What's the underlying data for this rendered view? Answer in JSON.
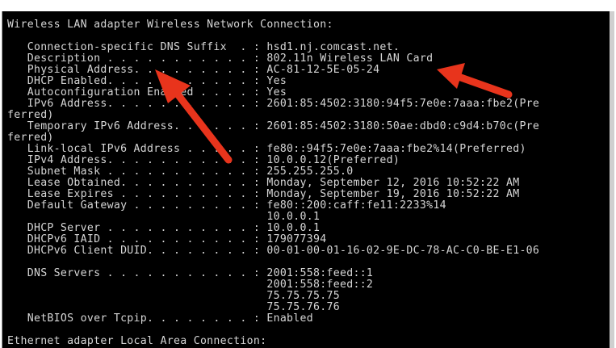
{
  "console": {
    "lines": [
      "Wireless LAN adapter Wireless Network Connection:",
      "",
      "   Connection-specific DNS Suffix  . : hsd1.nj.comcast.net.",
      "   Description . . . . . . . . . . . : 802.11n Wireless LAN Card",
      "   Physical Address. . . . . . . . . : AC-81-12-5E-05-24",
      "   DHCP Enabled. . . . . . . . . . . : Yes",
      "   Autoconfiguration Enabled . . . . : Yes",
      "   IPv6 Address. . . . . . . . . . . : 2601:85:4502:3180:94f5:7e0e:7aaa:fbe2(Pre",
      "ferred)",
      "   Temporary IPv6 Address. . . . . . : 2601:85:4502:3180:50ae:dbd0:c9d4:b70c(Pre",
      "ferred)",
      "   Link-local IPv6 Address . . . . . : fe80::94f5:7e0e:7aaa:fbe2%14(Preferred)",
      "   IPv4 Address. . . . . . . . . . . : 10.0.0.12(Preferred)",
      "   Subnet Mask . . . . . . . . . . . : 255.255.255.0",
      "   Lease Obtained. . . . . . . . . . : Monday, September 12, 2016 10:52:22 AM",
      "   Lease Expires . . . . . . . . . . : Monday, September 19, 2016 10:52:22 AM",
      "   Default Gateway . . . . . . . . . : fe80::200:caff:fe11:2233%14",
      "                                       10.0.0.1",
      "   DHCP Server . . . . . . . . . . . : 10.0.0.1",
      "   DHCPv6 IAID . . . . . . . . . . . : 179077394",
      "   DHCPv6 Client DUID. . . . . . . . : 00-01-00-01-16-02-9E-DC-78-AC-C0-BE-E1-06",
      "",
      "   DNS Servers . . . . . . . . . . . : 2001:558:feed::1",
      "                                       2001:558:feed::2",
      "                                       75.75.75.75",
      "                                       75.75.76.76",
      "   NetBIOS over Tcpip. . . . . . . . : Enabled",
      "",
      "Ethernet adapter Local Area Connection:"
    ]
  },
  "colors": {
    "background": "#000000",
    "text": "#d6d6d6",
    "arrow": "#e8341c"
  },
  "annotations": {
    "arrows": [
      "arrow-icon",
      "arrow-icon"
    ]
  }
}
